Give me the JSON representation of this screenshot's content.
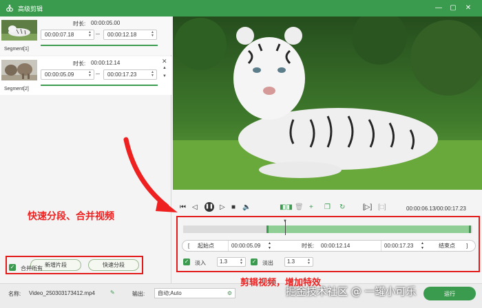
{
  "titlebar": {
    "title": "高级剪辑"
  },
  "segments": [
    {
      "name": "Segment[1]",
      "duration_label": "时长:",
      "duration": "00:00:05.00",
      "start": "00:00:07.18",
      "end": "00:00:12.18"
    },
    {
      "name": "Segment[2]",
      "duration_label": "时长:",
      "duration": "00:00:12.14",
      "start": "00:00:05.09",
      "end": "00:00:17.23"
    }
  ],
  "left_actions": {
    "add_segment": "新增片段",
    "quick_split": "快速分段",
    "merge_all": "合并所有",
    "merge_all_checked": true
  },
  "playback": {
    "current_time": "00:00:06.13",
    "total_time": "00:00:17.23",
    "separator": "/"
  },
  "range": {
    "start_bracket": "[",
    "start_label": "起始点",
    "start_value": "00:00:05.09",
    "duration_label": "时长:",
    "duration_value": "00:00:12.14",
    "end_value": "00:00:17.23",
    "end_label": "结束点",
    "end_bracket": "]"
  },
  "fade": {
    "fade_in_label": "淡入",
    "fade_in_value": "1.3",
    "fade_in_checked": true,
    "fade_out_label": "淡出",
    "fade_out_value": "1.3",
    "fade_out_checked": true
  },
  "bottom": {
    "name_label": "名称:",
    "file_name": "Video_250303173412.mp4",
    "output_label": "输出:",
    "output_value": "自动;Auto",
    "run_button": "运行"
  },
  "annotations": {
    "split_merge": "快速分段、合并视频",
    "edit_effects": "剪辑视频，增加特效"
  },
  "watermark": "掘金技术社区 @ 一罐小可乐",
  "colors": {
    "accent": "#3a9a4e",
    "annotation": "#ee2020"
  },
  "timeline": {
    "selection_start_fraction": 0.29,
    "selection_end_fraction": 1.0,
    "playhead_fraction": 0.36
  }
}
